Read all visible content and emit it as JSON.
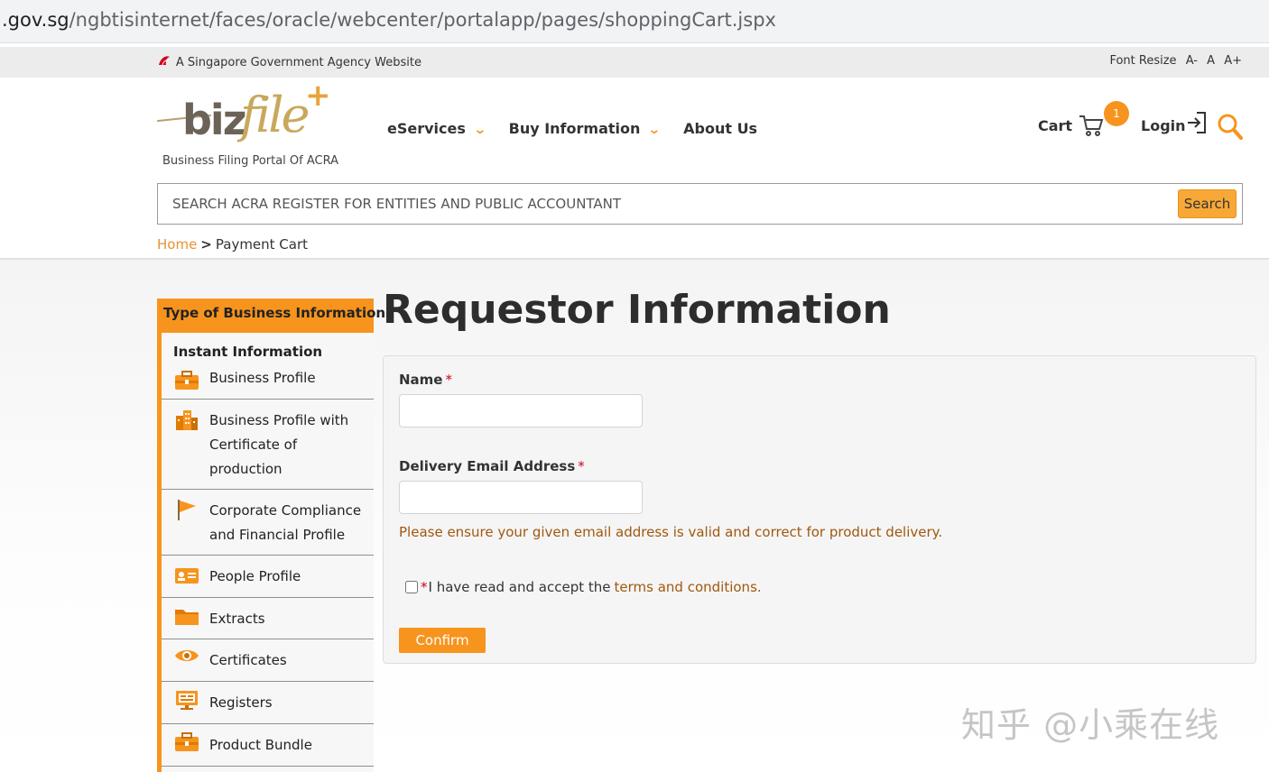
{
  "browser": {
    "url_domain": ".gov.sg",
    "url_path": "/ngbtisinternet/faces/oracle/webcenter/portalapp/pages/shoppingCart.jspx"
  },
  "gov_strip": {
    "agency_text": "A Singapore Government Agency Website",
    "font_resize_label": "Font Resize",
    "font_small": "A-",
    "font_normal": "A",
    "font_large": "A+"
  },
  "header": {
    "logo_biz": "biz",
    "logo_file": "file",
    "logo_plus": "+",
    "tagline": "Business Filing Portal Of ACRA",
    "nav": [
      {
        "label": "eServices",
        "has_caret": true
      },
      {
        "label": "Buy Information",
        "has_caret": true
      },
      {
        "label": "About Us",
        "has_caret": false
      }
    ],
    "cart_label": "Cart",
    "cart_count": "1",
    "login_label": "Login",
    "icons": {
      "cart": "cart-icon",
      "login": "login-icon",
      "search": "search-icon"
    },
    "accent_color": "#f7941d"
  },
  "search": {
    "placeholder": "SEARCH ACRA REGISTER FOR ENTITIES AND PUBLIC ACCOUNTANT",
    "button_label": "Search"
  },
  "breadcrumb": {
    "home": "Home",
    "separator": ">",
    "current": "Payment Cart"
  },
  "sidebar": {
    "heading": "Type of Business Information",
    "subheading": "Instant Information",
    "items": [
      {
        "label": "Business Profile",
        "icon": "briefcase-icon"
      },
      {
        "label": "Business Profile with Certificate of production",
        "icon": "buildings-icon"
      },
      {
        "label": "Corporate Compliance and Financial Profile",
        "icon": "flag-icon"
      },
      {
        "label": "People Profile",
        "icon": "id-card-icon"
      },
      {
        "label": "Extracts",
        "icon": "folder-icon"
      },
      {
        "label": "Certificates",
        "icon": "eye-icon"
      },
      {
        "label": "Registers",
        "icon": "monitor-icon"
      },
      {
        "label": "Product Bundle",
        "icon": "briefcase-icon"
      }
    ]
  },
  "form": {
    "title": "Requestor Information",
    "name_label": "Name",
    "name_value": "",
    "email_label": "Delivery Email Address",
    "email_value": "",
    "required_mark": "*",
    "email_note": "Please ensure your given email address is valid and correct for product delivery.",
    "terms_text": "I have read and accept the",
    "terms_link": "terms and conditions.",
    "terms_checked": false,
    "confirm_label": "Confirm"
  },
  "watermark": "知乎 @小乘在线"
}
